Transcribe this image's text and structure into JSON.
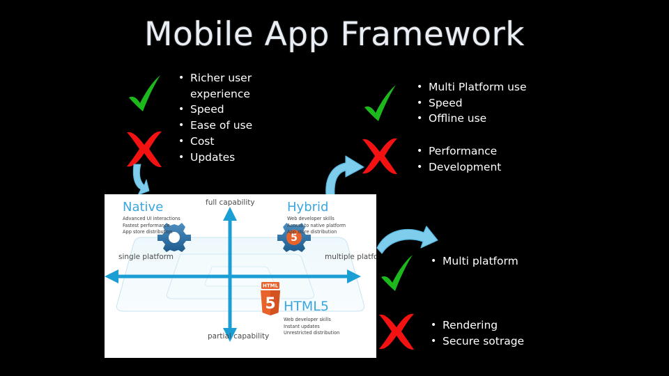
{
  "slide": {
    "title": "Mobile App Framework",
    "background_color": "#000000",
    "title_color": "#e9eef5"
  },
  "colors": {
    "check_green": "#1cb81c",
    "cross_red": "#f21212",
    "arrow_blue": "#7fcdec",
    "diagram_cyan": "#1b9ed4",
    "diagram_heading_blue": "#3aa6dd",
    "panel_white": "#ffffff"
  },
  "columns": {
    "native": {
      "pros": {
        "icon": "check-icon",
        "items": [
          "Richer user experience",
          "Speed",
          "Ease of use"
        ]
      },
      "cons": {
        "icon": "cross-icon",
        "items": [
          "Cost",
          "Updates"
        ]
      }
    },
    "hybrid": {
      "pros": {
        "icon": "check-icon",
        "items": [
          "Multi Platform use",
          "Speed",
          "Offline use"
        ]
      },
      "cons": {
        "icon": "cross-icon",
        "items": [
          "Performance",
          "Development"
        ]
      }
    },
    "html5": {
      "pros": {
        "icon": "check-icon",
        "items": [
          "Multi platform"
        ]
      },
      "cons": {
        "icon": "cross-icon",
        "items": [
          "Rendering",
          "Secure sotrage"
        ]
      }
    }
  },
  "bullet_char": "•",
  "diagram": {
    "native": {
      "heading": "Native",
      "features": [
        "Advanced UI interactions",
        "Fastest performance",
        "App store distribution"
      ]
    },
    "hybrid": {
      "heading": "Hybrid",
      "features": [
        "Web developer skills",
        "Access to native platform",
        "App store distribution"
      ]
    },
    "html5": {
      "heading": "HTML5",
      "features": [
        "Web developer skills",
        "Instant updates",
        "Unrestricted distribution"
      ]
    },
    "axes": {
      "top": "full capability",
      "left": "single platform",
      "right": "multiple platforms",
      "bottom": "partial capability"
    },
    "logo_text": "HTML",
    "logo_number": "5"
  }
}
